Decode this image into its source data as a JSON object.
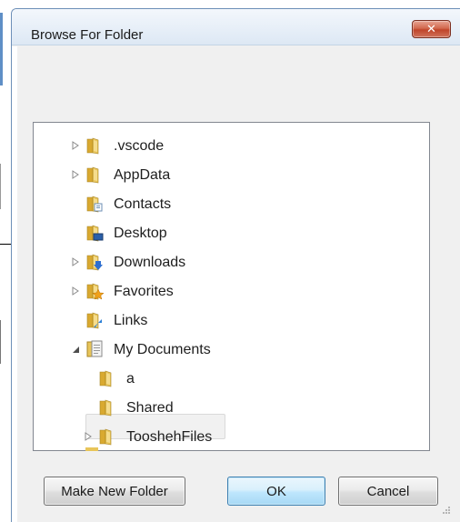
{
  "window": {
    "title": "Browse For Folder",
    "close_glyph": "✕"
  },
  "tree": {
    "items": [
      {
        "label": ".vscode",
        "icon": "folder-icon",
        "expander": "collapsed",
        "level": 1
      },
      {
        "label": "AppData",
        "icon": "folder-icon",
        "expander": "collapsed",
        "level": 1
      },
      {
        "label": "Contacts",
        "icon": "contacts-folder-icon",
        "expander": "none",
        "level": 1
      },
      {
        "label": "Desktop",
        "icon": "desktop-folder-icon",
        "expander": "none",
        "level": 1
      },
      {
        "label": "Downloads",
        "icon": "downloads-folder-icon",
        "expander": "collapsed",
        "level": 1
      },
      {
        "label": "Favorites",
        "icon": "favorites-folder-icon",
        "expander": "collapsed",
        "level": 1
      },
      {
        "label": "Links",
        "icon": "links-folder-icon",
        "expander": "none",
        "level": 1
      },
      {
        "label": "My Documents",
        "icon": "documents-library-icon",
        "expander": "expanded",
        "level": 1
      },
      {
        "label": "a",
        "icon": "folder-icon",
        "expander": "none",
        "level": 2
      },
      {
        "label": "Shared",
        "icon": "folder-icon",
        "expander": "none",
        "level": 2
      },
      {
        "label": "TooshehFiles",
        "icon": "folder-icon",
        "expander": "collapsed",
        "level": 2,
        "selected": true
      }
    ]
  },
  "buttons": {
    "make_new_folder": "Make New Folder",
    "ok": "OK",
    "cancel": "Cancel"
  },
  "colors": {
    "titlebar": "#dde8f4",
    "close_button": "#c0452a",
    "default_button": "#bee6fd",
    "folder_yellow": "#e8c55a"
  }
}
